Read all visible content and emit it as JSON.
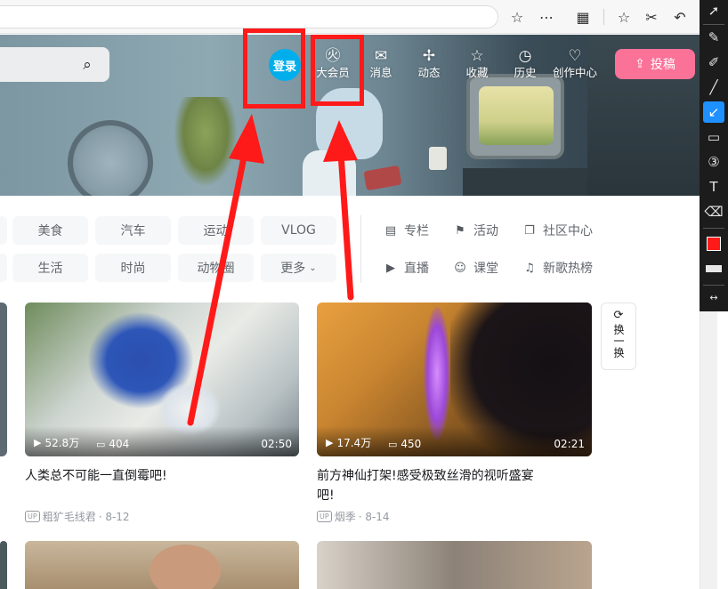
{
  "header": {
    "avatar_label": "登录",
    "nav": [
      {
        "label": "大会员",
        "icon": "vip-icon"
      },
      {
        "label": "消息",
        "icon": "mail-icon"
      },
      {
        "label": "动态",
        "icon": "pinwheel-icon"
      },
      {
        "label": "收藏",
        "icon": "star-icon"
      },
      {
        "label": "历史",
        "icon": "clock-icon"
      },
      {
        "label": "创作中心",
        "icon": "bulb-icon"
      }
    ],
    "upload_label": "投稿"
  },
  "categories": {
    "row1": [
      "美食",
      "汽车",
      "运动",
      "VLOG"
    ],
    "row2": [
      "生活",
      "时尚",
      "动物圈",
      "更多"
    ]
  },
  "side_links": {
    "row1": [
      "专栏",
      "活动",
      "社区中心"
    ],
    "row2": [
      "直播",
      "课堂",
      "新歌热榜"
    ]
  },
  "videos": [
    {
      "title": "人类总不可能一直倒霉吧!",
      "views": "52.8万",
      "danmaku": "404",
      "duration": "02:50",
      "uploader": "粗犷毛线君",
      "date": "· 8-12"
    },
    {
      "title": "前方神仙打架!感受极致丝滑的视听盛宴吧!",
      "title_line1": "前方神仙打架!感受极致丝滑的视听盛宴",
      "title_line2": "吧!",
      "views": "17.4万",
      "danmaku": "450",
      "duration": "02:21",
      "uploader": "烟季",
      "date": "· 8-14"
    }
  ],
  "refresh_label": "换一换",
  "up_badge": "UP",
  "colors": {
    "accent_pink": "#fb7299",
    "avatar_blue": "#00aeec",
    "annotation_red": "#ff1a1a",
    "toolbar_active": "#1e90ff"
  }
}
